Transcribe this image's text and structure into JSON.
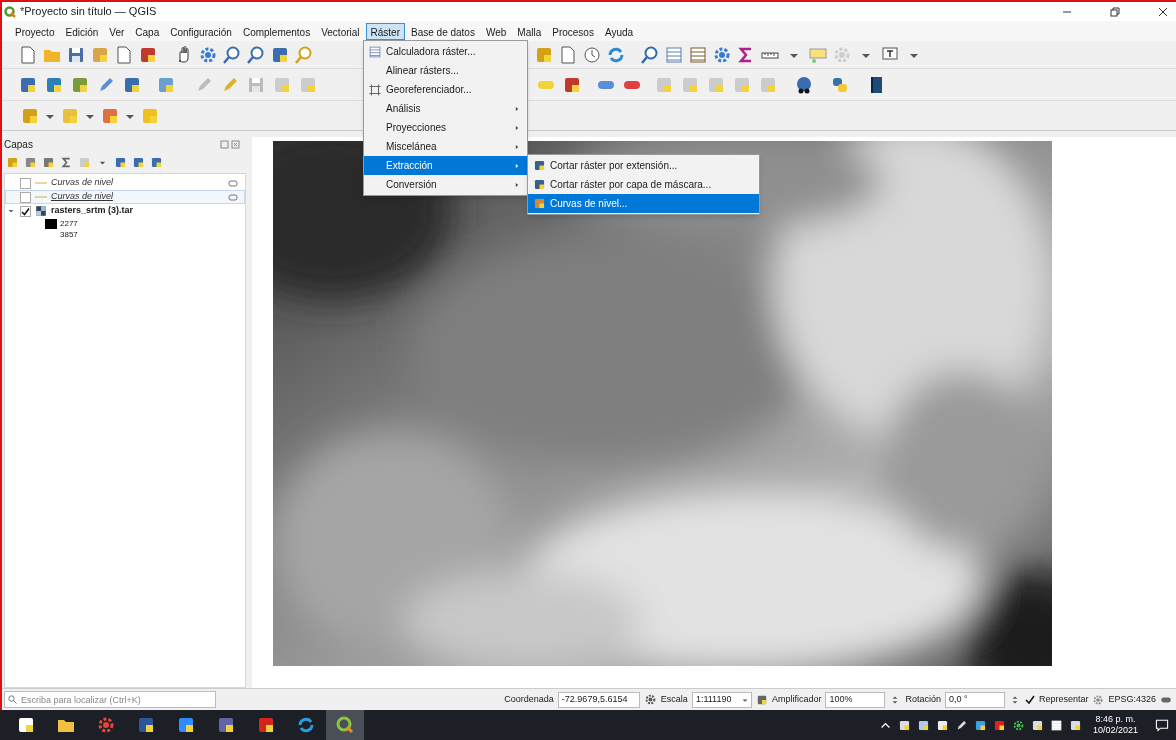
{
  "window": {
    "title": "*Proyecto sin título — QGIS"
  },
  "menu_bar": [
    {
      "label": "Proyecto",
      "selected": false
    },
    {
      "label": "Edición",
      "selected": false
    },
    {
      "label": "Ver",
      "selected": false
    },
    {
      "label": "Capa",
      "selected": false
    },
    {
      "label": "Configuración",
      "selected": false
    },
    {
      "label": "Complementos",
      "selected": false
    },
    {
      "label": "Vectorial",
      "selected": false
    },
    {
      "label": "Ráster",
      "selected": true
    },
    {
      "label": "Base de datos",
      "selected": false
    },
    {
      "label": "Web",
      "selected": false
    },
    {
      "label": "Malla",
      "selected": false
    },
    {
      "label": "Procesos",
      "selected": false
    },
    {
      "label": "Ayuda",
      "selected": false
    }
  ],
  "raster_menu": [
    {
      "label": "Calculadora ráster...",
      "submenu": false,
      "selected": false
    },
    {
      "label": "Alinear rásters...",
      "submenu": false,
      "selected": false
    },
    {
      "label": "Georeferenciador...",
      "submenu": false,
      "selected": false
    },
    {
      "label": "Análisis",
      "submenu": true,
      "selected": false
    },
    {
      "label": "Proyecciones",
      "submenu": true,
      "selected": false
    },
    {
      "label": "Miscelánea",
      "submenu": true,
      "selected": false
    },
    {
      "label": "Extracción",
      "submenu": true,
      "selected": true
    },
    {
      "label": "Conversión",
      "submenu": true,
      "selected": false
    }
  ],
  "extraction_submenu": [
    {
      "label": "Cortar ráster por extensión...",
      "selected": false
    },
    {
      "label": "Cortar ráster por capa de máscara...",
      "selected": false
    },
    {
      "label": "Curvas de nivel...",
      "selected": true
    }
  ],
  "layers_panel": {
    "title": "Capas",
    "layers": [
      {
        "label": "Curvas de nivel",
        "kind": "vector",
        "checked": false,
        "selected": false
      },
      {
        "label": "Curvas de nivel",
        "kind": "vector",
        "checked": false,
        "selected": true
      },
      {
        "label": "rasters_srtm (3).tar",
        "kind": "raster",
        "checked": true,
        "selected": false,
        "expanded": true,
        "legend": [
          {
            "label": "2277",
            "color": "#000000"
          },
          {
            "label": "3857"
          }
        ]
      }
    ]
  },
  "locator": {
    "placeholder": "Escriba para localizar (Ctrl+K)"
  },
  "status_bar": {
    "coordinate_label": "Coordenada",
    "coordinate": "-72.9679,5.6154",
    "scale_label": "Escala",
    "scale": "1:111190",
    "magnifier_label": "Amplificador",
    "magnifier": "100%",
    "rotation_label": "Rotación",
    "rotation": "0,0 °",
    "render": {
      "label": "Representar",
      "checked": true
    },
    "crs": "EPSG:4326"
  },
  "taskbar": {
    "time": "8:46 p. m.",
    "date": "10/02/2021"
  }
}
